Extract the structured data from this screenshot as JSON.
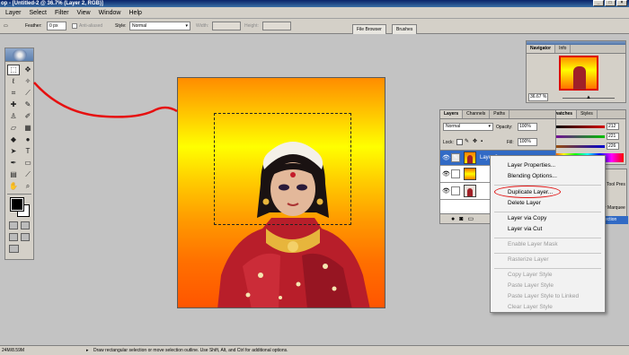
{
  "window": {
    "title": "op - [Untitled-2 @ 36.7% (Layer 2, RGB)]"
  },
  "menu": [
    "Layer",
    "Select",
    "Filter",
    "View",
    "Window",
    "Help"
  ],
  "options": {
    "feather_label": "Feather:",
    "feather_value": "0 px",
    "antialiased_label": "Anti-aliased",
    "style_label": "Style:",
    "style_value": "Normal",
    "width_label": "Width:",
    "height_label": "Height:",
    "well_tabs": [
      "File Browser",
      "Brushes"
    ]
  },
  "navigator": {
    "tabs": [
      "Navigator",
      "Info"
    ],
    "zoom": "36.67 %"
  },
  "color_panel": {
    "tabs": [
      "Swatches",
      "Styles"
    ],
    "values": [
      "212",
      "221",
      "226"
    ],
    "bar_colors": [
      "#d40000",
      "#00c000",
      "#0000d0"
    ]
  },
  "layers_panel": {
    "tabs": [
      "Layers",
      "Channels",
      "Paths"
    ],
    "blend_mode": "Normal",
    "opacity_label": "Opacity:",
    "opacity_value": "100%",
    "lock_label": "Lock:",
    "fill_label": "Fill:",
    "fill_value": "100%",
    "layers": [
      {
        "name": "Layer 2",
        "selected": true
      },
      {
        "name": ""
      },
      {
        "name": ""
      }
    ]
  },
  "context_menu": {
    "items": [
      {
        "label": "Layer Properties...",
        "enabled": true
      },
      {
        "label": "Blending Options...",
        "enabled": true
      },
      {
        "label": "Duplicate Layer...",
        "enabled": true,
        "highlighted": true
      },
      {
        "label": "Delete Layer",
        "enabled": true
      },
      {
        "label": "Layer via Copy",
        "enabled": true
      },
      {
        "label": "Layer via Cut",
        "enabled": true
      },
      {
        "label": "Enable Layer Mask",
        "enabled": false
      },
      {
        "label": "Rasterize Layer",
        "enabled": false
      },
      {
        "label": "Copy Layer Style",
        "enabled": false
      },
      {
        "label": "Paste Layer Style",
        "enabled": false
      },
      {
        "label": "Paste Layer Style to Linked",
        "enabled": false
      },
      {
        "label": "Clear Layer Style",
        "enabled": false
      }
    ]
  },
  "behind_menu": {
    "labels": [
      "ction",
      "Tool Pres",
      "r Marquee",
      "ection"
    ]
  },
  "status": {
    "size": "24M/8.59M",
    "hint": "Draw rectangular selection or move selection outline. Use Shift, Alt, and Ctrl for additional options."
  }
}
